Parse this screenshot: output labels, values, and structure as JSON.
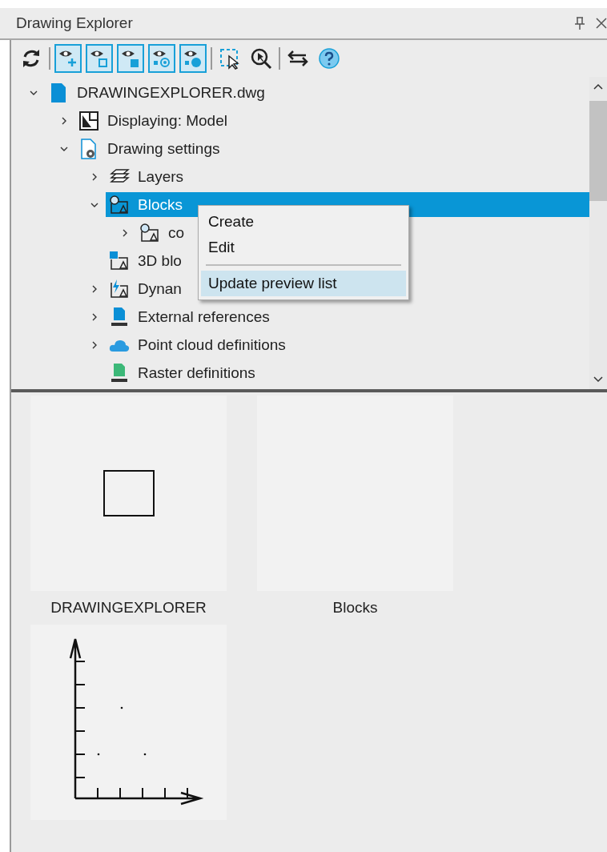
{
  "window": {
    "title": "Drawing Explorer"
  },
  "toolbar": [
    {
      "kind": "refresh"
    },
    {
      "kind": "separator"
    },
    {
      "kind": "eye-plus",
      "on": true
    },
    {
      "kind": "eye-outline-square",
      "on": true
    },
    {
      "kind": "eye-filled-square",
      "on": true
    },
    {
      "kind": "eye-target",
      "on": true
    },
    {
      "kind": "eye-half",
      "on": true
    },
    {
      "kind": "separator"
    },
    {
      "kind": "select"
    },
    {
      "kind": "zoom-select"
    },
    {
      "kind": "separator"
    },
    {
      "kind": "swap"
    },
    {
      "kind": "help"
    }
  ],
  "tree": [
    {
      "label": "DRAWINGEXPLORER.dwg",
      "kind": "file",
      "expanded": true,
      "selected": false,
      "children": [
        {
          "label": "Displaying: Model",
          "kind": "layout",
          "expanded": false,
          "selected": false
        },
        {
          "label": "Drawing settings",
          "kind": "settings",
          "expanded": true,
          "selected": false,
          "children": [
            {
              "label": "Layers",
              "kind": "layers",
              "expanded": false,
              "selected": false
            },
            {
              "label": "Blocks",
              "kind": "block",
              "expanded": true,
              "selected": true,
              "children": [
                {
                  "label": "co",
                  "kind": "block",
                  "expanded": false,
                  "selected": false
                }
              ]
            },
            {
              "label": "3D blo",
              "kind": "cube",
              "selected": false
            },
            {
              "label": "Dynan",
              "kind": "dynamic",
              "expanded": false,
              "selected": false
            },
            {
              "label": "External references",
              "kind": "dwg",
              "expanded": false,
              "selected": false
            },
            {
              "label": "Point cloud definitions",
              "kind": "cloud",
              "expanded": false,
              "selected": false
            },
            {
              "label": "Raster definitions",
              "kind": "img",
              "selected": false
            }
          ]
        }
      ]
    }
  ],
  "context_menu": [
    {
      "kind": "item",
      "label": "Create",
      "highlighted": false
    },
    {
      "kind": "item",
      "label": "Edit",
      "highlighted": false
    },
    {
      "kind": "separator"
    },
    {
      "kind": "item",
      "label": "Update preview list",
      "highlighted": true
    }
  ],
  "previews": [
    {
      "kind": "square",
      "label": "DRAWINGEXPLORER"
    },
    {
      "kind": "empty",
      "label": "Blocks"
    },
    {
      "kind": "plot"
    }
  ]
}
